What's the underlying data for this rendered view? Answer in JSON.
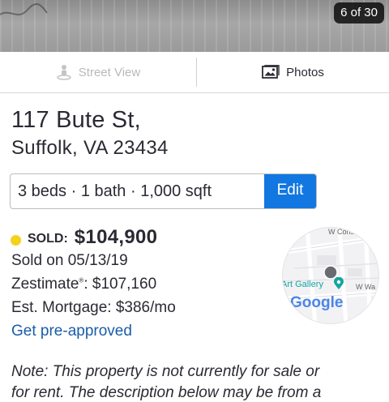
{
  "gallery": {
    "counter": "6 of 30"
  },
  "tabs": {
    "street_view_label": "Street View",
    "photos_label": "Photos"
  },
  "address": {
    "street": "117 Bute St,",
    "city_state_zip": "Suffolk, VA 23434"
  },
  "facts": {
    "summary": "3 beds · 1 bath · 1,000 sqft",
    "edit_label": "Edit"
  },
  "listing": {
    "status_label": "SOLD:",
    "price": "$104,900",
    "sold_on": "Sold on 05/13/19",
    "zestimate_label": "Zestimate",
    "zestimate_mark": "®",
    "zestimate_value": ": $107,160",
    "mortgage": "Est. Mortgage: $386/mo",
    "preapproved_link": "Get pre-approved"
  },
  "map": {
    "street_label_top": "W Cons",
    "poi_label": "Art Gallery",
    "street_label_right": "W Wa",
    "brand": "Google"
  },
  "note": {
    "line1": "Note: This property is not currently for sale or",
    "line2": "for rent. The description below may be from a"
  },
  "colors": {
    "accent_blue": "#1277e1",
    "link_blue": "#1b5da8",
    "sold_dot": "#f4d21a",
    "text": "#2a2a33"
  }
}
